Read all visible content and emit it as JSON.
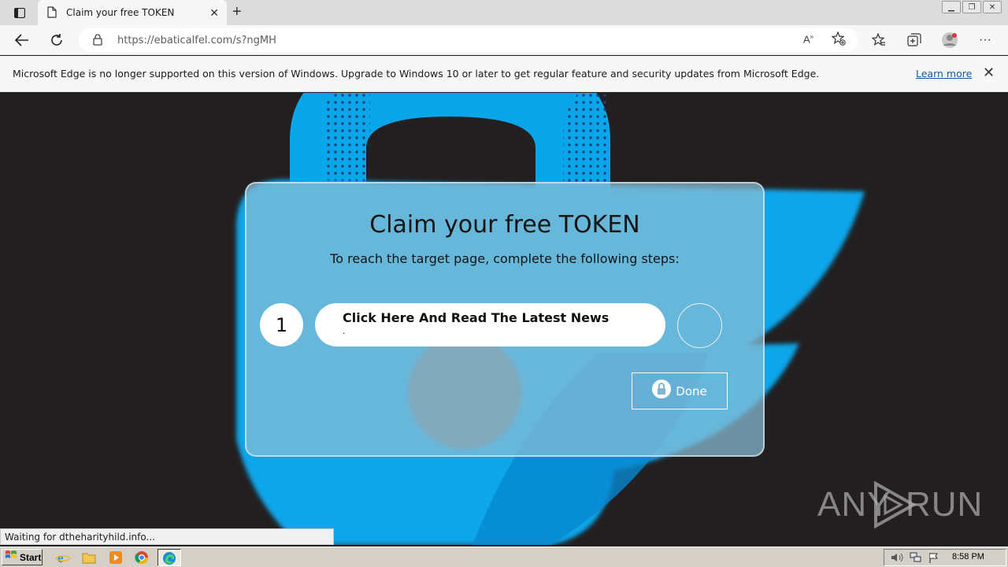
{
  "browser": {
    "tab_title": "Claim your free TOKEN",
    "url": "https://ebaticalfel.com/s?ngMH",
    "icons": [
      "tab-actions-icon",
      "page-icon",
      "close-icon",
      "plus-icon",
      "back-icon",
      "refresh-icon",
      "lock-icon",
      "read-aloud-icon",
      "add-favorite-icon",
      "favorites-icon",
      "collections-icon",
      "profile-icon",
      "more-icon"
    ]
  },
  "infobar": {
    "message": "Microsoft Edge is no longer supported on this version of Windows. Upgrade to Windows 10 or later to get regular feature and security updates from Microsoft Edge.",
    "link": "Learn more"
  },
  "page": {
    "title": "Claim your free TOKEN",
    "subtitle": "To reach the target page, complete the following steps:",
    "steps": [
      {
        "number": "1",
        "label": "Click Here And Read The Latest News",
        "sub": "."
      }
    ],
    "done_label": "Done",
    "colors": {
      "background": "#231f20",
      "card": "#8abed6",
      "lock_blue": "#0aa6ea"
    }
  },
  "watermark": {
    "left": "ANY",
    "right": "RUN"
  },
  "status": {
    "text": "Waiting for dtheharityhild.info..."
  },
  "taskbar": {
    "start_label": "Start",
    "clock": "8:58 PM",
    "icons": [
      "windows-logo-icon",
      "internet-explorer-icon",
      "folder-icon",
      "media-player-icon",
      "chrome-icon",
      "edge-icon",
      "volume-icon",
      "network-icon",
      "flag-icon"
    ]
  }
}
